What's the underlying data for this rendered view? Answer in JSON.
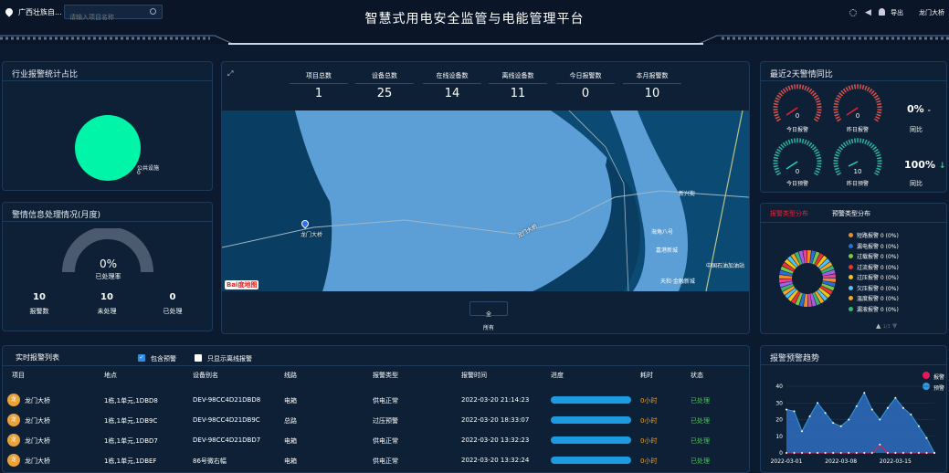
{
  "header": {
    "location": "广西壮族自...",
    "search_placeholder": "请输入项目名称",
    "title": "智慧式用电安全监管与电能管理平台",
    "logout": "导出",
    "user": "龙门大桥"
  },
  "industry": {
    "title": "行业报警统计占比",
    "pie_label": "公共设施",
    "pie_value": "0"
  },
  "handling": {
    "title": "警情信息处理情况(月度)",
    "percent": "0%",
    "percent_label": "已处理率",
    "stats": [
      {
        "value": "10",
        "label": "报警数"
      },
      {
        "value": "10",
        "label": "未处理"
      },
      {
        "value": "0",
        "label": "已处理"
      }
    ]
  },
  "stats": [
    {
      "label": "项目总数",
      "value": "1"
    },
    {
      "label": "设备总数",
      "value": "25"
    },
    {
      "label": "在线设备数",
      "value": "14"
    },
    {
      "label": "离线设备数",
      "value": "11"
    },
    {
      "label": "今日报警数",
      "value": "0"
    },
    {
      "label": "本月报警数",
      "value": "10"
    }
  ],
  "map": {
    "labels": [
      "龙门大桥",
      "龙门大桥",
      "海角八号",
      "嘉港新城",
      "中国石油加油站",
      "天和·金融新城",
      "新兴街"
    ],
    "logo": "Bai度地图",
    "filter_icon_label": "全",
    "filter_label": "所有"
  },
  "compare": {
    "title": "最近2天警情同比",
    "gauges": [
      {
        "value": "0",
        "label": "今日报警"
      },
      {
        "value": "0",
        "label": "昨日报警"
      },
      {
        "value": "0",
        "label": "今日预警"
      },
      {
        "value": "10",
        "label": "昨日预警"
      }
    ],
    "ratios": [
      {
        "value": "0%",
        "arrow": "-",
        "label": "同比"
      },
      {
        "value": "100%",
        "arrow": "↓",
        "label": "同比"
      }
    ]
  },
  "types": {
    "tab_active": "报警类型分布",
    "tab_other": "预警类型分布",
    "pager": "1/3",
    "legend": [
      {
        "name": "短路报警 0 (0%)",
        "color": "#f08a24"
      },
      {
        "name": "漏电报警 0 (0%)",
        "color": "#2b6cd8"
      },
      {
        "name": "过载报警 0 (0%)",
        "color": "#7ac943"
      },
      {
        "name": "过流报警 0 (0%)",
        "color": "#e33"
      },
      {
        "name": "过压报警 0 (0%)",
        "color": "#f2c511"
      },
      {
        "name": "欠压报警 0 (0%)",
        "color": "#4ec3f0"
      },
      {
        "name": "温度报警 0 (0%)",
        "color": "#f5a623"
      },
      {
        "name": "漏液报警 0 (0%)",
        "color": "#3cb371"
      }
    ]
  },
  "realtime": {
    "title": "实时报警列表",
    "check1": "包含预警",
    "check2": "只显示离线报警",
    "columns": [
      "项目",
      "地点",
      "设备别名",
      "线路",
      "报警类型",
      "报警时间",
      "进度",
      "耗时",
      "状态"
    ],
    "rows": [
      {
        "avatar": "龙",
        "project": "龙门大桥",
        "place": "1栋,1单元,1DBD8",
        "device": "DEV-98CC4D21DBD8",
        "line": "电箱",
        "type": "供电正常",
        "time": "2022-03-20 21:14:23",
        "cost": "0小时",
        "status": "已处理"
      },
      {
        "avatar": "龙",
        "project": "龙门大桥",
        "place": "1栋,1单元,1DB9C",
        "device": "DEV-98CC4D21DB9C",
        "line": "总路",
        "type": "过压预警",
        "time": "2022-03-20 18:33:07",
        "cost": "0小时",
        "status": "已处理"
      },
      {
        "avatar": "龙",
        "project": "龙门大桥",
        "place": "1栋,1单元,1DBD7",
        "device": "DEV-98CC4D21DBD7",
        "line": "电箱",
        "type": "供电正常",
        "time": "2022-03-20 13:32:23",
        "cost": "0小时",
        "status": "已处理"
      },
      {
        "avatar": "龙",
        "project": "龙门大桥",
        "place": "1栋,1单元,1DBEF",
        "device": "86号微右幅",
        "line": "电箱",
        "type": "供电正常",
        "time": "2022-03-20 13:32:24",
        "cost": "0小时",
        "status": "已处理"
      }
    ]
  },
  "trend": {
    "title": "报警预警趋势",
    "legend": [
      {
        "name": "报警",
        "color": "#e8195a"
      },
      {
        "name": "预警",
        "color": "#2f9be0"
      }
    ]
  },
  "chart_data": {
    "type": "area",
    "x": [
      "2022-03-01",
      "2022-03-02",
      "2022-03-03",
      "2022-03-04",
      "2022-03-05",
      "2022-03-06",
      "2022-03-07",
      "2022-03-08",
      "2022-03-09",
      "2022-03-10",
      "2022-03-11",
      "2022-03-12",
      "2022-03-13",
      "2022-03-14",
      "2022-03-15",
      "2022-03-16",
      "2022-03-17",
      "2022-03-18",
      "2022-03-19",
      "2022-03-20"
    ],
    "xticks": [
      "2022-03-01",
      "2022-03-08",
      "2022-03-15"
    ],
    "yticks": [
      "0",
      "10",
      "20",
      "30",
      "40"
    ],
    "ylim": [
      0,
      40
    ],
    "series": [
      {
        "name": "报警",
        "values": [
          0,
          0,
          0,
          0,
          0,
          0,
          0,
          0,
          0,
          0,
          0,
          0,
          5,
          0,
          0,
          0,
          0,
          0,
          0,
          0
        ]
      },
      {
        "name": "预警",
        "values": [
          26,
          25,
          13,
          22,
          30,
          24,
          18,
          16,
          20,
          28,
          36,
          26,
          20,
          27,
          33,
          27,
          23,
          16,
          9,
          0
        ]
      }
    ]
  }
}
